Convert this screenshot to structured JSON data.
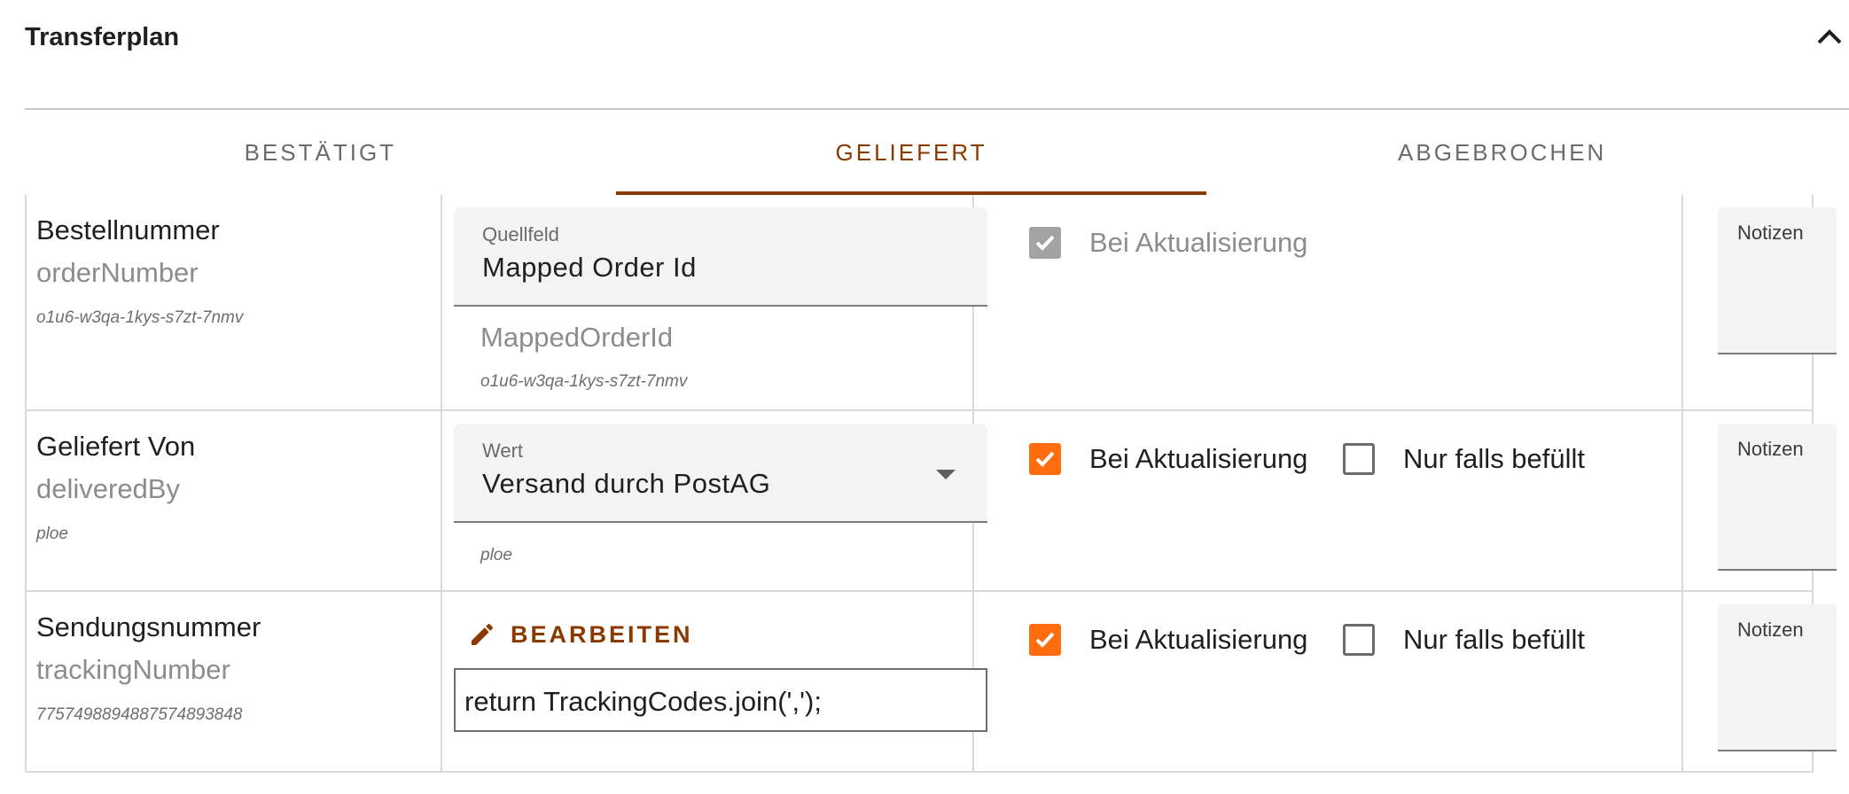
{
  "panel": {
    "title": "Transferplan",
    "collapse_icon": "chevron-up-icon"
  },
  "tabs": [
    {
      "label": "BESTÄTIGT",
      "active": false
    },
    {
      "label": "GELIEFERT",
      "active": true
    },
    {
      "label": "ABGEBROCHEN",
      "active": false
    }
  ],
  "colors": {
    "accent": "#8a3a00",
    "checkbox_checked": "#ff6d0f",
    "checkbox_disabled": "#a3a3a3"
  },
  "rows": [
    {
      "target_label": "Bestellnummer",
      "target_key": "orderNumber",
      "target_id": "o1u6-w3qa-1kys-s7zt-7nmv",
      "source": {
        "type": "field",
        "field_label": "Quellfeld",
        "field_value": "Mapped Order Id",
        "key": "MappedOrderId",
        "id": "o1u6-w3qa-1kys-s7zt-7nmv"
      },
      "options": {
        "on_update_label": "Bei Aktualisierung",
        "on_update_checked": true,
        "on_update_disabled": true
      },
      "notes_label": "Notizen"
    },
    {
      "target_label": "Geliefert Von",
      "target_key": "deliveredBy",
      "target_id": "ploe",
      "source": {
        "type": "value",
        "field_label": "Wert",
        "field_value": "Versand durch PostAG",
        "id": "ploe"
      },
      "options": {
        "on_update_label": "Bei Aktualisierung",
        "on_update_checked": true,
        "only_if_filled_label": "Nur falls befüllt",
        "only_if_filled_checked": false
      },
      "notes_label": "Notizen"
    },
    {
      "target_label": "Sendungsnummer",
      "target_key": "trackingNumber",
      "target_id": "7757498894887574893848",
      "source": {
        "type": "script",
        "edit_label": "BEARBEITEN",
        "edit_icon": "pencil-icon",
        "code": "return TrackingCodes.join(',');"
      },
      "options": {
        "on_update_label": "Bei Aktualisierung",
        "on_update_checked": true,
        "only_if_filled_label": "Nur falls befüllt",
        "only_if_filled_checked": false
      },
      "notes_label": "Notizen"
    }
  ]
}
